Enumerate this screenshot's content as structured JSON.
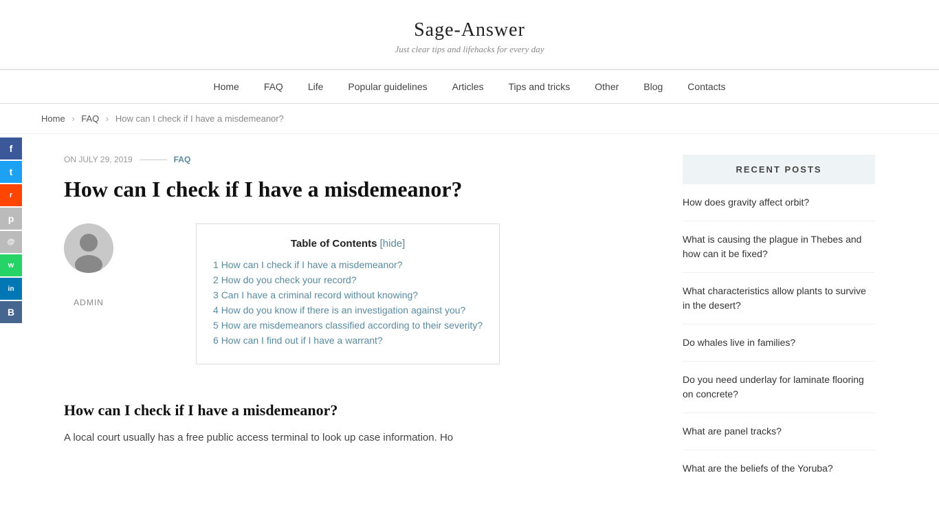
{
  "site": {
    "title": "Sage-Answer",
    "tagline": "Just clear tips and lifehacks for every day"
  },
  "nav": {
    "items": [
      {
        "label": "Home",
        "href": "#"
      },
      {
        "label": "FAQ",
        "href": "#"
      },
      {
        "label": "Life",
        "href": "#"
      },
      {
        "label": "Popular guidelines",
        "href": "#"
      },
      {
        "label": "Articles",
        "href": "#"
      },
      {
        "label": "Tips and tricks",
        "href": "#"
      },
      {
        "label": "Other",
        "href": "#"
      },
      {
        "label": "Blog",
        "href": "#"
      },
      {
        "label": "Contacts",
        "href": "#"
      }
    ]
  },
  "breadcrumb": {
    "home": "Home",
    "faq": "FAQ",
    "current": "How can I check if I have a misdemeanor?"
  },
  "social": {
    "buttons": [
      {
        "label": "f",
        "name": "facebook"
      },
      {
        "label": "t",
        "name": "twitter"
      },
      {
        "label": "r",
        "name": "reddit"
      },
      {
        "label": "p",
        "name": "pinterest"
      },
      {
        "label": "@",
        "name": "email"
      },
      {
        "label": "w",
        "name": "whatsapp"
      },
      {
        "label": "in",
        "name": "linkedin"
      },
      {
        "label": "B",
        "name": "vk"
      }
    ]
  },
  "article": {
    "date": "ON JULY 29, 2019",
    "category": "FAQ",
    "title": "How can I check if I have a misdemeanor?",
    "author": "ADMIN",
    "toc": {
      "title": "Table of Contents",
      "hide_label": "[hide]",
      "items": [
        {
          "num": "1",
          "text": "How can I check if I have a misdemeanor?"
        },
        {
          "num": "2",
          "text": "How do you check your record?"
        },
        {
          "num": "3",
          "text": "Can I have a criminal record without knowing?"
        },
        {
          "num": "4",
          "text": "How do you know if there is an investigation against you?"
        },
        {
          "num": "5",
          "text": "How are misdemeanors classified according to their severity?"
        },
        {
          "num": "6",
          "text": "How can I find out if I have a warrant?"
        }
      ]
    },
    "first_section_heading": "How can I check if I have a misdemeanor?",
    "first_section_text": "A local court usually has a free public access terminal to look up case information. Ho"
  },
  "sidebar": {
    "recent_posts_title": "RECENT POSTS",
    "posts": [
      {
        "title": "How does gravity affect orbit?"
      },
      {
        "title": "What is causing the plague in Thebes and how can it be fixed?"
      },
      {
        "title": "What characteristics allow plants to survive in the desert?"
      },
      {
        "title": "Do whales live in families?"
      },
      {
        "title": "Do you need underlay for laminate flooring on concrete?"
      },
      {
        "title": "What are panel tracks?"
      },
      {
        "title": "What are the beliefs of the Yoruba?"
      }
    ]
  }
}
